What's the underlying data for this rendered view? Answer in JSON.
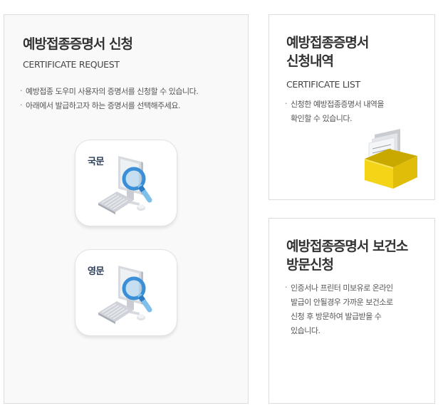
{
  "request_panel": {
    "title": "예방접종증명서 신청",
    "subtitle": "CERTIFICATE REQUEST",
    "bullets": [
      "예방접종 도우미 사용자의 증명서를 신청할 수 있습니다.",
      "아래에서 발급하고자 하는 증명서를 선택해주세요."
    ],
    "options": [
      {
        "label": "국문",
        "icon": "computer-search-icon"
      },
      {
        "label": "영문",
        "icon": "computer-search-icon"
      }
    ]
  },
  "list_panel": {
    "title_line1": "예방접종증명서",
    "title_line2": "신청내역",
    "subtitle": "CERTIFICATE LIST",
    "bullet_line1": "신청한 예방접종증명서 내역을",
    "bullet_line2": "확인할 수 있습니다.",
    "icon": "document-box-icon"
  },
  "visit_panel": {
    "title_line1": "예방접종증명서 보건소",
    "title_line2": "방문신청",
    "bullet_line1": "인증서나 프린터 미보유로 온라인",
    "bullet_line2": "발급이 안될경우 가까운 보건소로",
    "bullet_line3": "신청 후 방문하여 발급받을 수",
    "bullet_line4": "있습니다."
  },
  "colors": {
    "title": "#333333",
    "card_label": "#2c3e55",
    "magnifier": "#3a8fd6",
    "box_yellow": "#f3d417"
  }
}
